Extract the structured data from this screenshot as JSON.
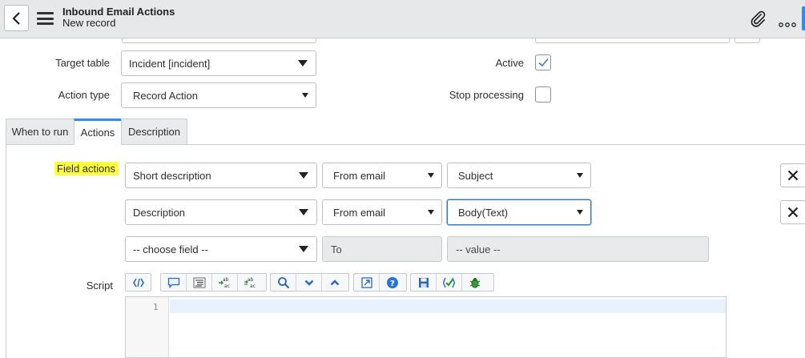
{
  "header": {
    "title": "Inbound Email Actions",
    "subtitle": "New record",
    "accent_color": "#278efc"
  },
  "form": {
    "target_table": {
      "label": "Target table",
      "value": "Incident [incident]"
    },
    "action_type": {
      "label": "Action type",
      "value": "Record Action"
    },
    "active": {
      "label": "Active",
      "checked": true
    },
    "stop_processing": {
      "label": "Stop processing",
      "checked": false
    }
  },
  "tabs": [
    {
      "label": "When to run",
      "active": false
    },
    {
      "label": "Actions",
      "active": true
    },
    {
      "label": "Description",
      "active": false
    }
  ],
  "field_actions": {
    "label": "Field actions",
    "rows": [
      {
        "field": "Short description",
        "source": "From email",
        "value": "Subject"
      },
      {
        "field": "Description",
        "source": "From email",
        "value": "Body(Text)"
      }
    ],
    "new_row": {
      "field": "-- choose field --",
      "source": "To",
      "value": "-- value --"
    }
  },
  "script": {
    "label": "Script",
    "line_numbers": [
      "1"
    ]
  },
  "icons": {
    "back": "chevron-left-icon",
    "menu": "hamburger-icon",
    "attach": "paperclip-icon",
    "more": "more-options-icon"
  }
}
